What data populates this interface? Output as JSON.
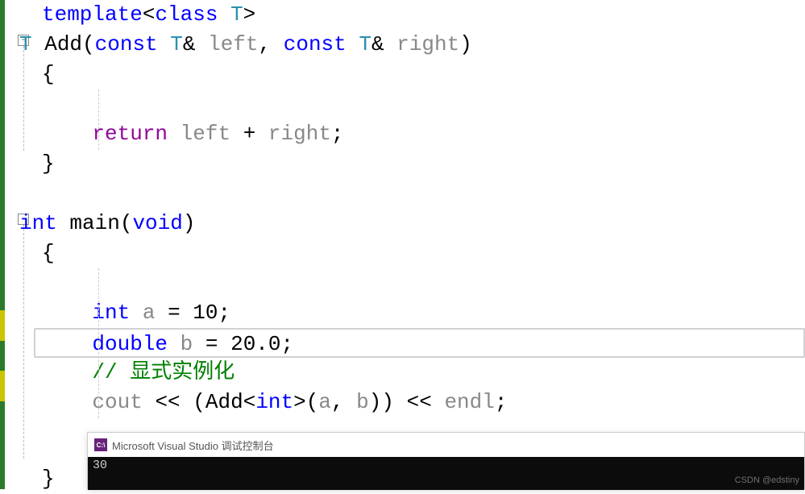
{
  "code": {
    "l1": {
      "template": "template",
      "open": "<",
      "class": "class",
      "T": "T",
      "close": ">"
    },
    "l2": {
      "T": "T",
      "Add": "Add",
      "open": "(",
      "const": "const",
      "T2": "T",
      "amp": "&",
      "left": "left",
      "comma": ",",
      "const2": "const",
      "T3": "T",
      "amp2": "&",
      "right": "right",
      "close": ")"
    },
    "l3": {
      "brace": "{"
    },
    "l4": {
      "ret": "return",
      "left": "left",
      "plus": "+",
      "right": "right",
      "semi": ";"
    },
    "l5": {
      "brace": "}"
    },
    "l6": {},
    "l7": {
      "int": "int",
      "main": "main",
      "open": "(",
      "void": "void",
      "close": ")"
    },
    "l8": {
      "brace": "{"
    },
    "l9": {},
    "l10": {
      "int": "int",
      "a": "a",
      "eq": "=",
      "val": "10",
      "semi": ";"
    },
    "l11": {
      "double": "double",
      "b": "b",
      "eq": "=",
      "val": "20.0",
      "semi": ";"
    },
    "l12": {
      "comment": "// 显式实例化"
    },
    "l13": {
      "cout": "cout",
      "ls": "<<",
      "open": "(",
      "Add": "Add",
      "lt": "<",
      "int": "int",
      "gt": ">",
      "op": "(",
      "a": "a",
      "comma": ",",
      "b": "b",
      "cp": ")",
      ")": ")",
      "ls2": "<<",
      "endl": "endl",
      "semi": ";"
    },
    "l14": {
      "brace": "}"
    }
  },
  "console": {
    "title": "Microsoft Visual Studio 调试控制台",
    "icon_label": "C:\\",
    "output": "30",
    "watermark": "CSDN @edstiny"
  }
}
